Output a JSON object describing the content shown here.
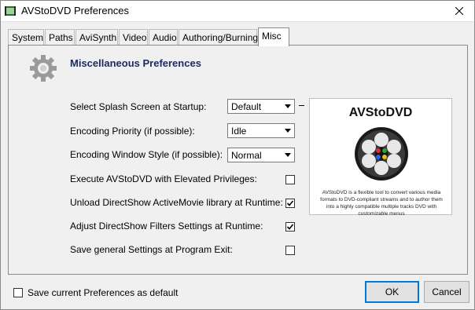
{
  "window": {
    "title": "AVStoDVD Preferences"
  },
  "tabs": [
    {
      "label": "System"
    },
    {
      "label": "Paths"
    },
    {
      "label": "AviSynth"
    },
    {
      "label": "Video"
    },
    {
      "label": "Audio"
    },
    {
      "label": "Authoring/Burning"
    },
    {
      "label": "Misc"
    }
  ],
  "panel": {
    "title": "Miscellaneous Preferences",
    "settings": [
      {
        "label": "Select Splash Screen at Startup:",
        "value": "Default"
      },
      {
        "label": "Encoding Priority (if possible):",
        "value": "Idle"
      },
      {
        "label": "Encoding Window Style (if possible):",
        "value": "Normal"
      },
      {
        "label": "Execute AVStoDVD with Elevated Privileges:",
        "checked": false
      },
      {
        "label": "Unload DirectShow ActiveMovie library at Runtime:",
        "checked": true
      },
      {
        "label": "Adjust DirectShow Filters Settings at Runtime:",
        "checked": true
      },
      {
        "label": "Save general Settings at Program Exit:",
        "checked": false
      }
    ],
    "preview": {
      "title": "AVStoDVD",
      "description": "AVStoDVD is a flexible tool to convert various media formats to DVD-compliant streams and to author them into a highly compatible multiple tracks DVD with customizable menus"
    }
  },
  "footer": {
    "save_default_label": "Save current Preferences as default",
    "save_default_checked": false,
    "ok_label": "OK",
    "cancel_label": "Cancel"
  },
  "colors": {
    "panel_title": "#1a2a5e",
    "ok_border": "#0078d7"
  }
}
